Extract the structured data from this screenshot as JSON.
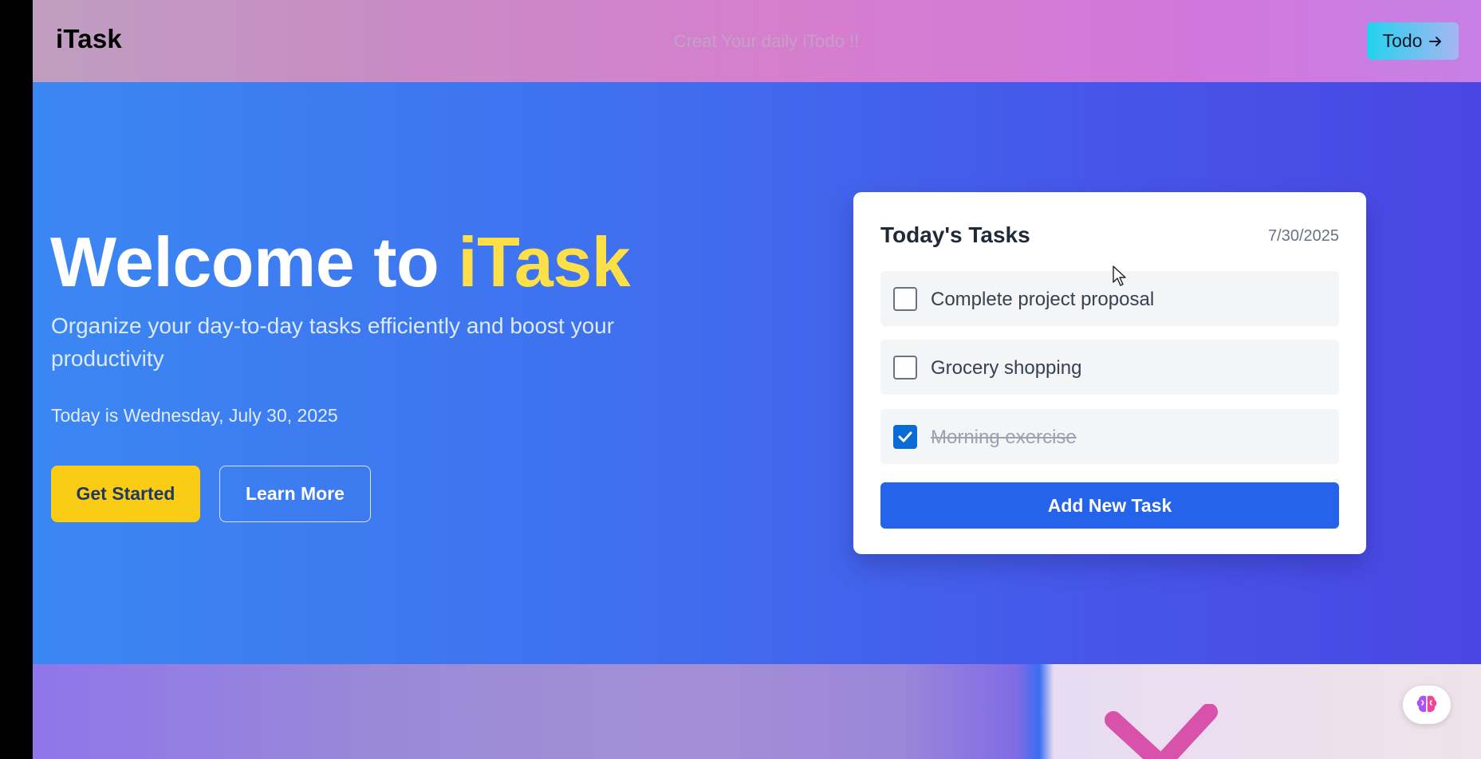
{
  "header": {
    "logo": "iTask",
    "tagline": "Creat Your daily iTodo !!",
    "todo_button": {
      "label": "Todo",
      "icon": "arrow-right-icon"
    }
  },
  "hero": {
    "title_prefix": "Welcome to ",
    "title_accent": "iTask",
    "subtitle": "Organize your day-to-day tasks efficiently and boost your productivity",
    "date_text": "Today is Wednesday, July 30, 2025",
    "primary_button": "Get Started",
    "secondary_button": "Learn More"
  },
  "card": {
    "title": "Today's Tasks",
    "date": "7/30/2025",
    "tasks": [
      {
        "label": "Complete project proposal",
        "checked": false
      },
      {
        "label": "Grocery shopping",
        "checked": false
      },
      {
        "label": "Morning exercise",
        "checked": true
      }
    ],
    "add_button": "Add New Task"
  },
  "floating_button": {
    "icon": "brain-icon"
  },
  "colors": {
    "accent_yellow": "#facc15",
    "title_accent": "#fde047",
    "primary_blue": "#2563eb",
    "checkbox_checked": "#0b6bd6"
  }
}
